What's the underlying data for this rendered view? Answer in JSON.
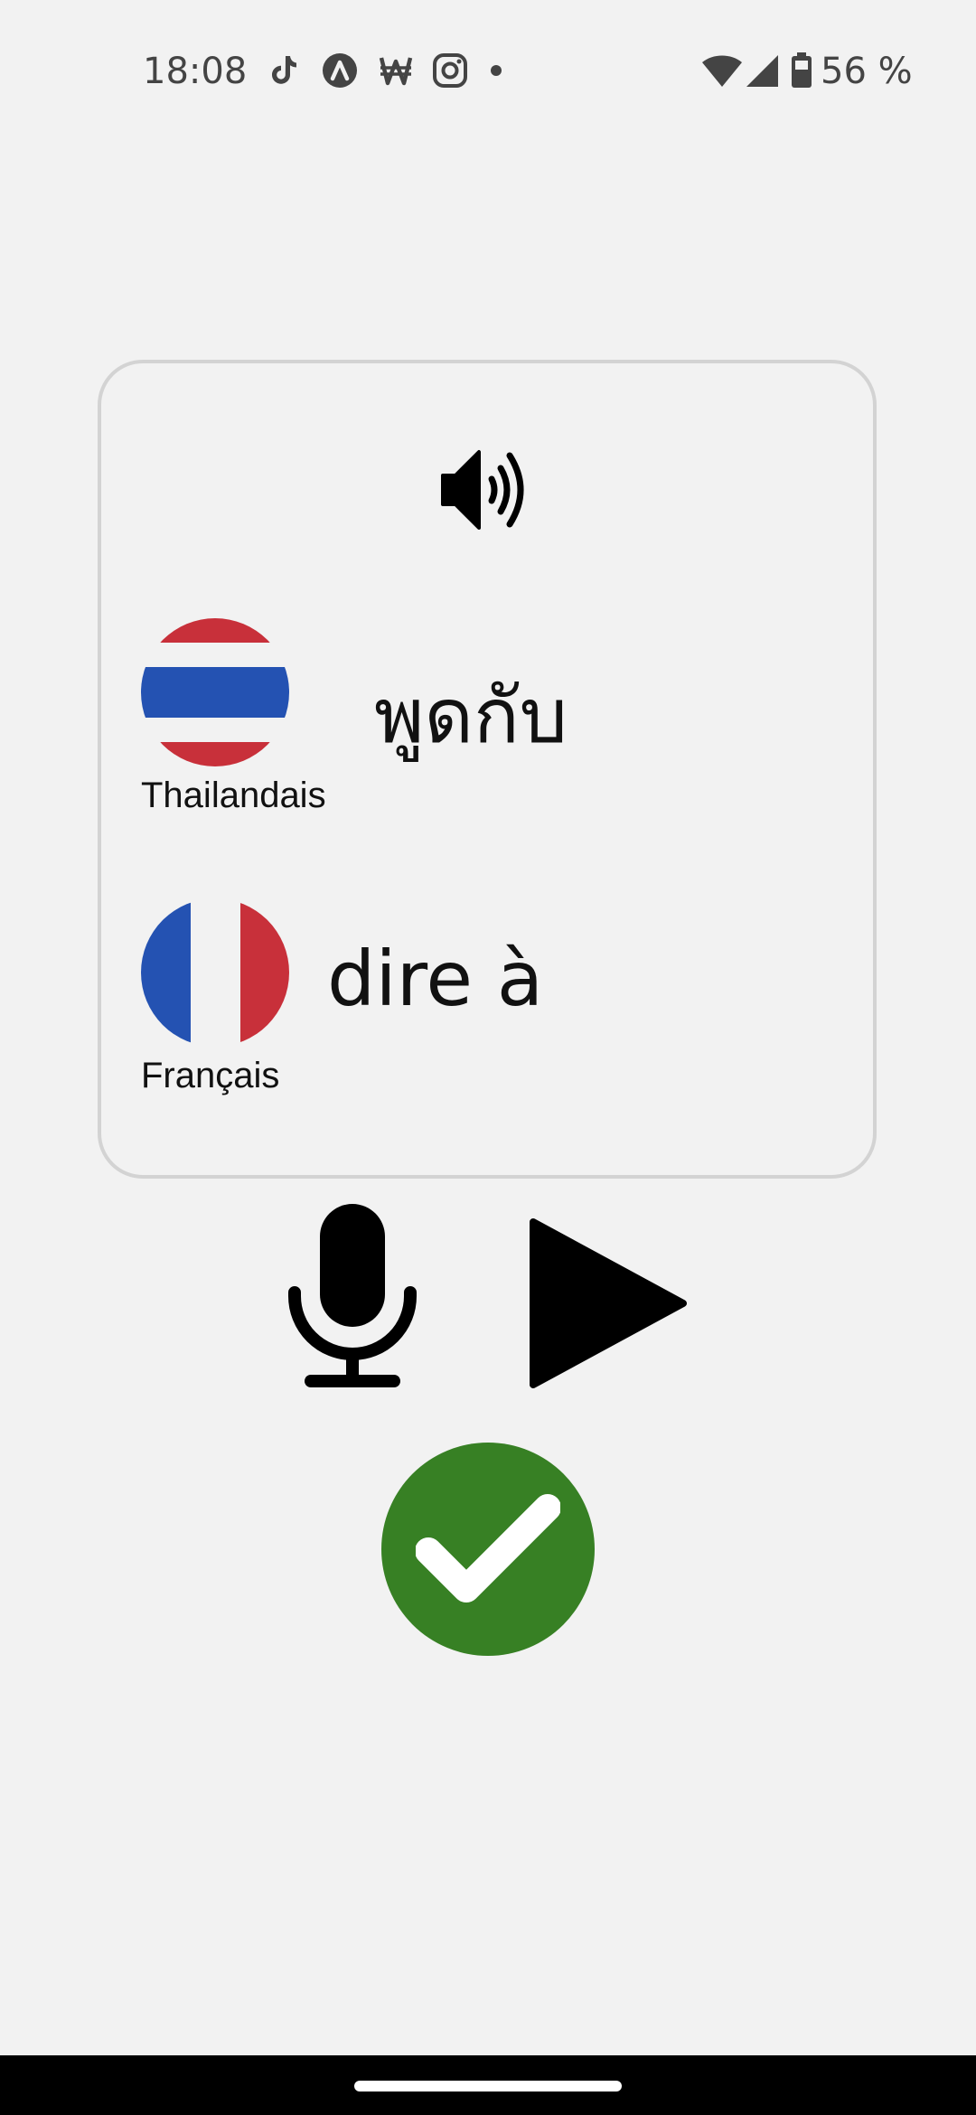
{
  "status_bar": {
    "time": "18:08",
    "battery_percent": "56 %",
    "notification_icons": [
      "tiktok-icon",
      "arc-icon",
      "won-icon",
      "instagram-icon",
      "dot-icon"
    ],
    "system_icons": [
      "wifi-icon",
      "cellular-signal-icon",
      "battery-icon"
    ]
  },
  "card": {
    "speaker_icon": "speaker-volume-icon",
    "source": {
      "language": "Thailandais",
      "phrase": "พูดกับ",
      "flag": "thailand-flag"
    },
    "target": {
      "language": "Français",
      "phrase": "dire à",
      "flag": "france-flag"
    }
  },
  "controls": {
    "mic_icon": "microphone-icon",
    "play_icon": "play-icon",
    "check_icon": "checkmark-icon"
  },
  "colors": {
    "background": "#f2f2f2",
    "card_border": "#d3d3d3",
    "check_green": "#378024",
    "flag_red": "#c8303a",
    "flag_blue": "#2452b2",
    "flag_white": "#f2f2f2"
  }
}
